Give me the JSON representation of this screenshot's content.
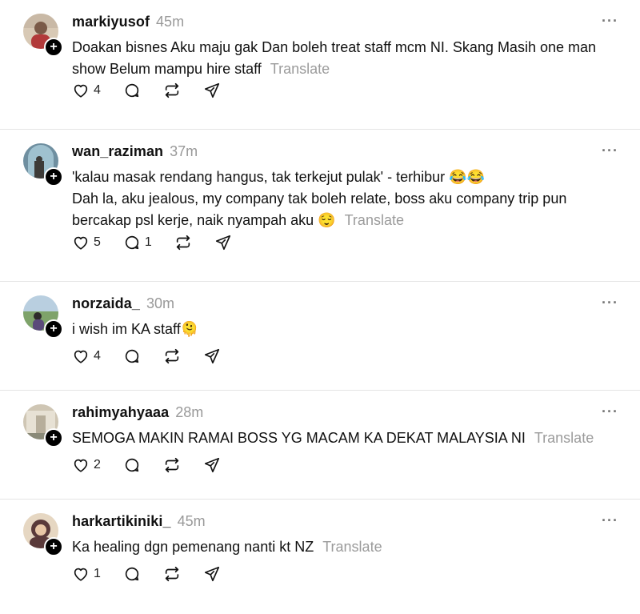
{
  "posts": [
    {
      "username": "markiyusof",
      "time": "45m",
      "text": "Doakan bisnes Aku maju gak Dan boleh treat staff mcm NI. Skang Masih one man show Belum mampu hire staff",
      "translate": "Translate",
      "likes": "4",
      "replies": "",
      "more": "···"
    },
    {
      "username": "wan_raziman",
      "time": "37m",
      "text_line1": "'kalau masak rendang hangus, tak terkejut pulak' - terhibur 😂😂",
      "text_line2": "Dah la, aku jealous, my company tak boleh relate, boss aku company trip pun bercakap psl kerje, naik nyampah aku 😌",
      "translate": "Translate",
      "likes": "5",
      "replies": "1",
      "more": "···"
    },
    {
      "username": "norzaida_",
      "time": "30m",
      "text": "i wish im KA staff🫠",
      "translate": "",
      "likes": "4",
      "replies": "",
      "more": "···"
    },
    {
      "username": "rahimyahyaaa",
      "time": "28m",
      "text": "SEMOGA MAKIN RAMAI BOSS YG MACAM KA DEKAT MALAYSIA NI",
      "translate": "Translate",
      "likes": "2",
      "replies": "",
      "more": "···"
    },
    {
      "username": "harkartikiniki_",
      "time": "45m",
      "text": "Ka healing dgn pemenang nanti kt NZ",
      "translate": "Translate",
      "likes": "1",
      "replies": "",
      "more": "···"
    }
  ],
  "icons": {
    "like": "heart-icon",
    "reply": "comment-icon",
    "repost": "repost-icon",
    "share": "share-icon",
    "follow": "plus-icon"
  }
}
